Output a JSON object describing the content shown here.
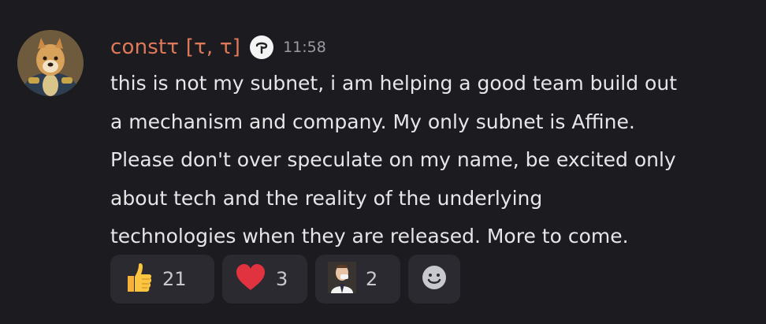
{
  "message": {
    "author": "constτ [τ, τ]",
    "timestamp": "11:58",
    "lines": [
      "this is not my subnet, i am helping a good team build out",
      "a mechanism and company. My only subnet is Affine.",
      "Please don't over speculate on my name, be excited only",
      "about tech and the reality of the underlying",
      "technologies when they are released. More to come."
    ]
  },
  "reactions": [
    {
      "icon": "thumbs-up-icon",
      "count": "21"
    },
    {
      "icon": "heart-icon",
      "count": "3"
    },
    {
      "icon": "custom-emoji-icon",
      "count": "2"
    }
  ],
  "colors": {
    "background": "#1c1c20",
    "username": "#e0785a",
    "text": "#e6e6e9",
    "timestamp": "#9a9aa2",
    "reaction_bg": "#2a2a30"
  }
}
